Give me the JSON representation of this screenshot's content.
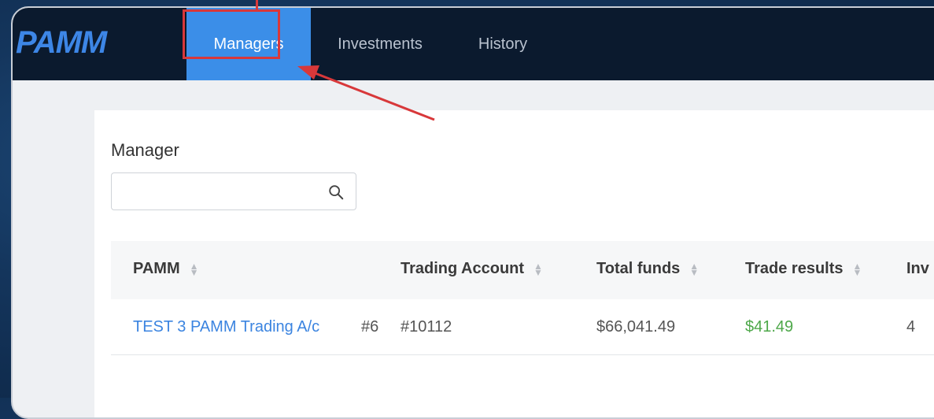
{
  "app": {
    "logo": "PAMM"
  },
  "nav": {
    "tabs": [
      {
        "label": "Managers",
        "active": true
      },
      {
        "label": "Investments",
        "active": false
      },
      {
        "label": "History",
        "active": false
      }
    ]
  },
  "manager_filter": {
    "label": "Manager",
    "value": "",
    "placeholder": ""
  },
  "table": {
    "headers": [
      "PAMM",
      "Trading Account",
      "Total funds",
      "Trade results",
      "Inv"
    ],
    "rows": [
      {
        "pamm": "TEST 3 PAMM Trading A/c",
        "id": "#6",
        "trading_account": "#10112",
        "total_funds": "$66,041.49",
        "trade_results": "$41.49",
        "investors": "4"
      }
    ]
  },
  "colors": {
    "nav_bg": "#0b1a2e",
    "active_tab": "#3b8ee8",
    "link": "#3b84e0",
    "positive": "#4ea84a",
    "annotation": "#d8383a"
  }
}
